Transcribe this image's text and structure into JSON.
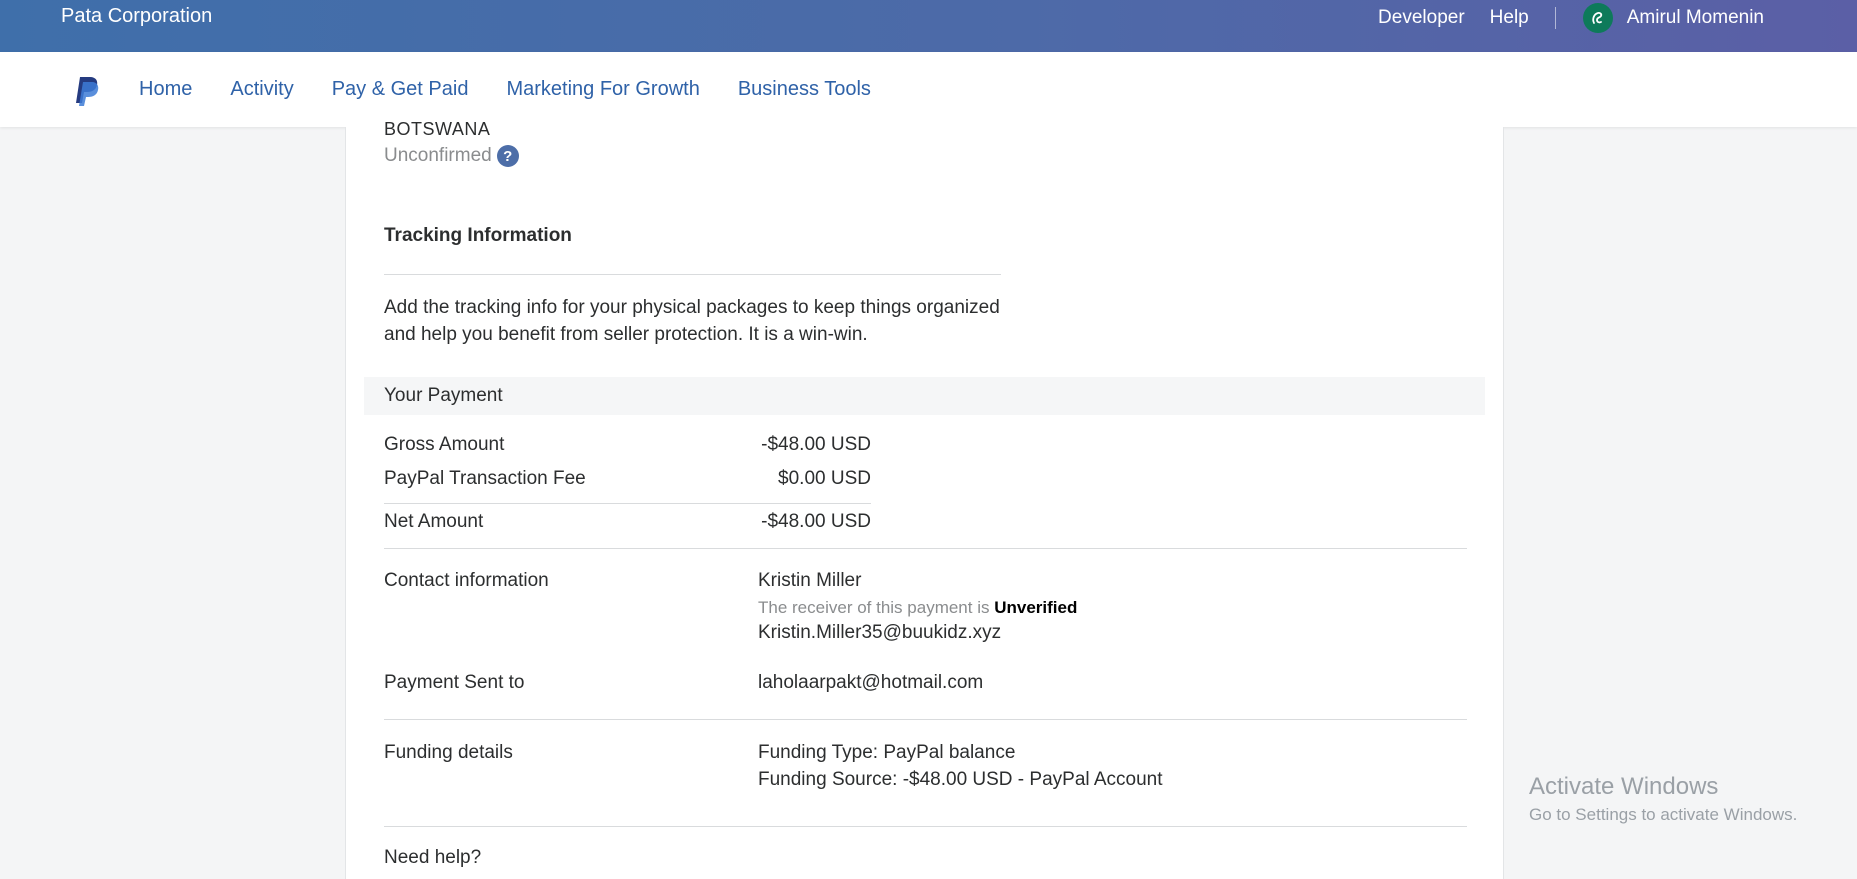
{
  "topbar": {
    "company": "Pata Corporation",
    "links": [
      "Developer",
      "Help"
    ],
    "user_name": "Amirul Momenin"
  },
  "nav": {
    "items": [
      "Home",
      "Activity",
      "Pay & Get Paid",
      "Marketing For Growth",
      "Business Tools"
    ]
  },
  "address": {
    "country": "BOTSWANA",
    "status": "Unconfirmed",
    "help_symbol": "?"
  },
  "tracking": {
    "title": "Tracking Information",
    "text": "Add the tracking info for your physical packages to keep things organized and help you benefit from seller protection. It is a win-win."
  },
  "payment": {
    "header": "Your Payment",
    "gross_label": "Gross Amount",
    "gross_value": "-$48.00 USD",
    "fee_label": "PayPal Transaction Fee",
    "fee_value": "$0.00 USD",
    "net_label": "Net Amount",
    "net_value": "-$48.00 USD"
  },
  "contact": {
    "label": "Contact information",
    "name": "Kristin Miller",
    "note_prefix": "The receiver of this payment is",
    "note_status": "Unverified",
    "email": "Kristin.Miller35@buukidz.xyz"
  },
  "sent_to": {
    "label": "Payment Sent to",
    "value": "laholaarpakt@hotmail.com"
  },
  "funding": {
    "label": "Funding details",
    "type": "Funding Type: PayPal balance",
    "source": "Funding Source: -$48.00 USD - PayPal Account"
  },
  "help": {
    "title": "Need help?"
  },
  "watermark": {
    "title": "Activate Windows",
    "subtitle": "Go to Settings to activate Windows."
  },
  "colors": {
    "brand_blue": "#2f62a8",
    "header_gradient_start": "#3f6faa",
    "header_gradient_end": "#5b5fa6"
  }
}
